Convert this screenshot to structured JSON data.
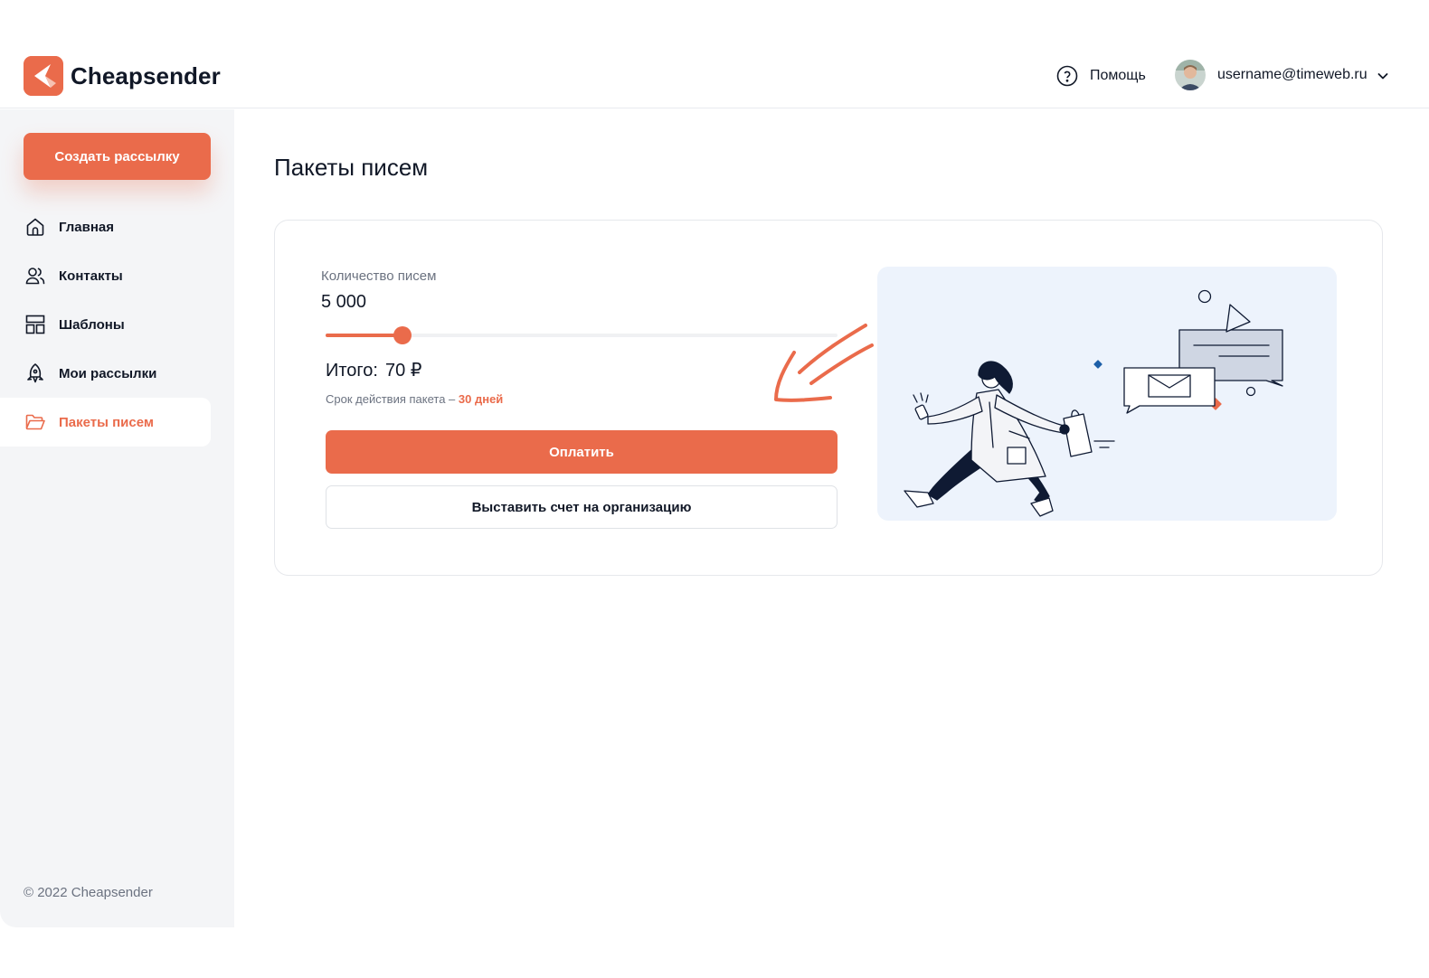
{
  "app": {
    "name": "Cheapsender",
    "brand_color": "#ea6b4b"
  },
  "header": {
    "help_label": "Помощь",
    "user_email": "username@timeweb.ru"
  },
  "sidebar": {
    "create_button": "Создать рассылку",
    "items": [
      {
        "label": "Главная",
        "icon": "home-icon",
        "active": false
      },
      {
        "label": "Контакты",
        "icon": "contacts-icon",
        "active": false
      },
      {
        "label": "Шаблоны",
        "icon": "templates-icon",
        "active": false
      },
      {
        "label": "Мои рассылки",
        "icon": "rocket-icon",
        "active": false
      },
      {
        "label": "Пакеты писем",
        "icon": "folder-icon",
        "active": true
      }
    ],
    "copyright": "© 2022 Cheapsender"
  },
  "main": {
    "title": "Пакеты писем",
    "quantity_label": "Количество писем",
    "quantity_value": "5 000",
    "slider_fraction": 0.15,
    "total_label": "Итого:",
    "total_value": "70 ₽",
    "validity_text": "Срок действия пакета –",
    "validity_days": "30 дней",
    "pay_button": "Оплатить",
    "invoice_button": "Выставить счет на организацию"
  }
}
